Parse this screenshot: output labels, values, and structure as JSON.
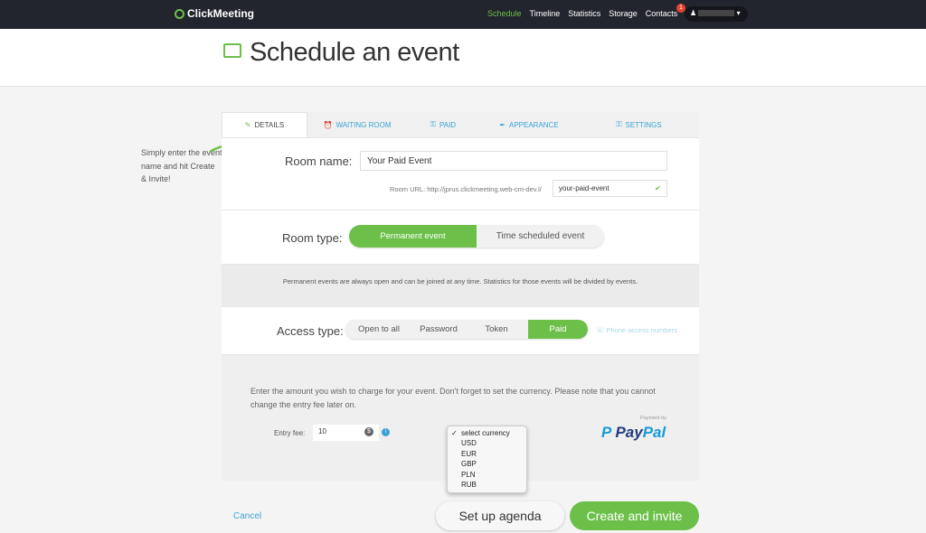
{
  "nav": {
    "logo": "ClickMeeting",
    "items": [
      "Schedule",
      "Timeline",
      "Statistics",
      "Storage",
      "Contacts"
    ],
    "active": "Schedule",
    "notification_count": "1"
  },
  "header": {
    "title": "Schedule an event"
  },
  "hint": "Simply enter the event name and hit Create & Invite!",
  "tabs": [
    {
      "label": "DETAILS",
      "icon": "pencil-icon"
    },
    {
      "label": "WAITING ROOM",
      "icon": "alarm-clock-icon"
    },
    {
      "label": "PAID",
      "icon": "key-icon"
    },
    {
      "label": "APPEARANCE",
      "icon": "brush-icon"
    },
    {
      "label": "SETTINGS",
      "icon": "wrench-icon"
    }
  ],
  "room": {
    "name_label": "Room name:",
    "name_value": "Your Paid Event",
    "url_label": "Room URL: http://jprus.clickmeeting.web-cm-dev.l/",
    "url_value": "your-paid-event"
  },
  "room_type": {
    "label": "Room type:",
    "options": [
      "Permanent event",
      "Time scheduled event"
    ],
    "selected": "Permanent event",
    "info": "Permanent events are always open and can be joined at any time. Statistics for those events will be divided by events."
  },
  "access": {
    "label": "Access type:",
    "options": [
      "Open to all",
      "Password",
      "Token",
      "Paid"
    ],
    "selected": "Paid",
    "phone_link": "Phone access numbers"
  },
  "paid": {
    "info": "Enter the amount you wish to charge for your event. Don't forget to set the currency. Please note that you cannot change the entry fee later on.",
    "fee_label": "Entry fee:",
    "fee_value": "10",
    "payment_by": "Payment by",
    "paypal": "PayPal"
  },
  "currency": {
    "options": [
      "select currency",
      "USD",
      "EUR",
      "GBP",
      "PLN",
      "RUB"
    ],
    "selected": "select currency"
  },
  "footer": {
    "cancel": "Cancel",
    "agenda": "Set up agenda",
    "create": "Create and invite"
  },
  "colors": {
    "accent": "#6cc04a",
    "link": "#3aa3d6",
    "nav_bg": "#23252e"
  }
}
